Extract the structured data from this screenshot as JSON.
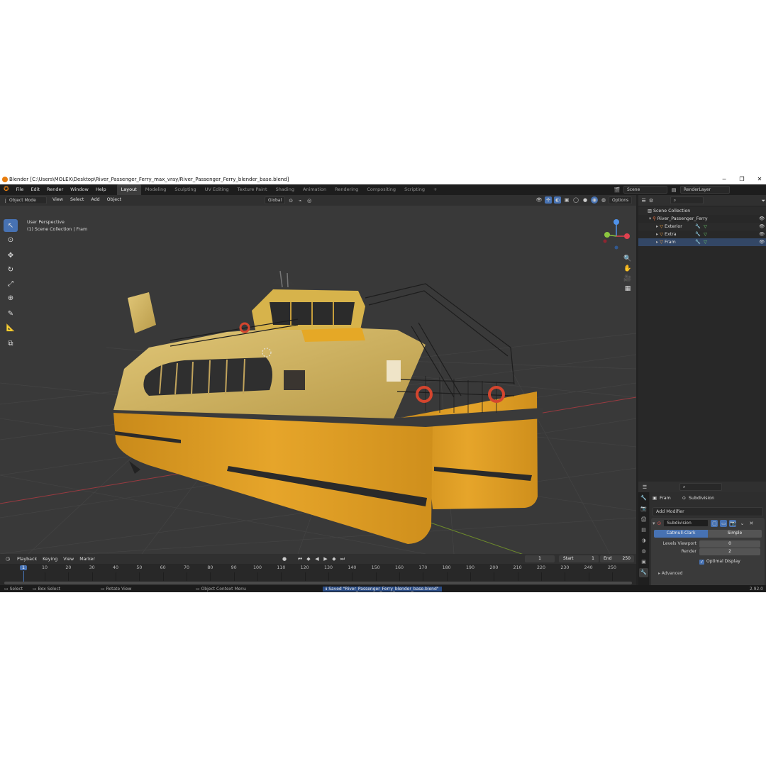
{
  "window": {
    "title": "Blender [C:\\Users\\MOLEX\\Desktop\\River_Passenger_Ferry_max_vray/River_Passenger_Ferry_blender_base.blend]",
    "min": "−",
    "max": "❐",
    "close": "✕"
  },
  "menu": [
    "File",
    "Edit",
    "Render",
    "Window",
    "Help"
  ],
  "workspaces": [
    "Layout",
    "Modeling",
    "Sculpting",
    "UV Editing",
    "Texture Paint",
    "Shading",
    "Animation",
    "Rendering",
    "Compositing",
    "Scripting"
  ],
  "workspace_add": "+",
  "scene": {
    "label": "Scene",
    "layer": "RenderLayer"
  },
  "viewport_header": {
    "mode": "Object Mode",
    "view": "View",
    "select": "Select",
    "add": "Add",
    "object": "Object",
    "transform": "Global",
    "options": "Options"
  },
  "overlay": {
    "perspective": "User Perspective",
    "collection": "(1) Scene Collection | Fram"
  },
  "outliner": {
    "root": "Scene Collection",
    "items": [
      {
        "label": "River_Passenger_Ferry"
      },
      {
        "label": "Exterior"
      },
      {
        "label": "Extra"
      },
      {
        "label": "Fram"
      }
    ]
  },
  "properties": {
    "object": "Fram",
    "modifier_name_header": "Subdivision",
    "add_modifier": "Add Modifier",
    "modifier": {
      "name": "Subdivision",
      "tab_catmull": "Catmull-Clark",
      "tab_simple": "Simple",
      "levels_label": "Levels Viewport",
      "levels_value": "0",
      "render_label": "Render",
      "render_value": "2",
      "optimal_label": "Optimal Display",
      "advanced": "Advanced"
    }
  },
  "timeline": {
    "playback": "Playback",
    "keying": "Keying",
    "view": "View",
    "marker": "Marker",
    "current_frame": "1",
    "start_label": "Start",
    "start": "1",
    "end_label": "End",
    "end": "250",
    "ticks": [
      "1",
      "10",
      "20",
      "30",
      "40",
      "50",
      "60",
      "70",
      "80",
      "90",
      "100",
      "110",
      "120",
      "130",
      "140",
      "150",
      "160",
      "170",
      "180",
      "190",
      "200",
      "210",
      "220",
      "230",
      "240",
      "250"
    ]
  },
  "status": {
    "select": "Select",
    "box_select": "Box Select",
    "rotate": "Rotate View",
    "context": "Object Context Menu",
    "saved": "Saved \"River_Passenger_Ferry_blender_base.blend\"",
    "version": "2.92.0"
  },
  "colors": {
    "accent": "#4772b3",
    "hull": "#e0a325",
    "upper": "#d8be6a",
    "axis_x": "#e0414f",
    "axis_y": "#8cc63f",
    "axis_z": "#4f92ea"
  },
  "icons": [
    "blender-logo-icon",
    "cursor-icon",
    "move-icon",
    "rotate-icon",
    "scale-icon",
    "transform-icon",
    "annotate-icon",
    "measure-icon",
    "add-cube-icon",
    "zoom-icon",
    "hand-icon",
    "camera-icon",
    "grid-icon",
    "eye-icon",
    "wrench-icon"
  ]
}
